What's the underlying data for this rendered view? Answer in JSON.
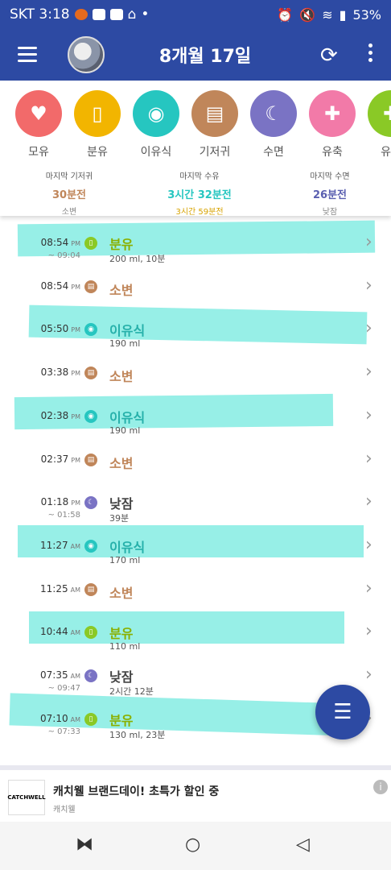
{
  "status": {
    "left": "SKT 3:18",
    "battery": "53%"
  },
  "header": {
    "title": "8개월 17일"
  },
  "colors": {
    "primary": "#2d4aa3",
    "highlight": "#2fe0d0"
  },
  "categories": [
    {
      "label": "모유",
      "icon": "breastfeeding-icon",
      "color": "#f26a6a"
    },
    {
      "label": "분유",
      "icon": "bottle-icon",
      "color": "#f2b500"
    },
    {
      "label": "이유식",
      "icon": "babyfood-icon",
      "color": "#26c6c0"
    },
    {
      "label": "기저귀",
      "icon": "diaper-icon",
      "color": "#c0865a"
    },
    {
      "label": "수면",
      "icon": "sleep-icon",
      "color": "#7a73c4"
    },
    {
      "label": "유축",
      "icon": "pump-icon",
      "color": "#f27aa8"
    },
    {
      "label": "유축",
      "icon": "pump-icon",
      "color": "#8ac926"
    }
  ],
  "summary": [
    {
      "title": "마지막 기저귀",
      "value": "30분전",
      "sub": "소변"
    },
    {
      "title": "마지막 수유",
      "value": "3시간 32분전",
      "sub": "3시간 59분전"
    },
    {
      "title": "마지막 수면",
      "value": "26분전",
      "sub": "낮잠"
    }
  ],
  "records": [
    {
      "time": "08:54",
      "ampm": "PM",
      "end": "~ 09:04",
      "name": "분유",
      "detail": "200 ml, 10분",
      "type": "bottle"
    },
    {
      "time": "08:54",
      "ampm": "PM",
      "end": "",
      "name": "소변",
      "detail": "",
      "type": "diaper"
    },
    {
      "time": "05:50",
      "ampm": "PM",
      "end": "",
      "name": "이유식",
      "detail": "190 ml",
      "type": "food"
    },
    {
      "time": "03:38",
      "ampm": "PM",
      "end": "",
      "name": "소변",
      "detail": "",
      "type": "diaper"
    },
    {
      "time": "02:38",
      "ampm": "PM",
      "end": "",
      "name": "이유식",
      "detail": "190 ml",
      "type": "food"
    },
    {
      "time": "02:37",
      "ampm": "PM",
      "end": "",
      "name": "소변",
      "detail": "",
      "type": "diaper"
    },
    {
      "time": "01:18",
      "ampm": "PM",
      "end": "~ 01:58",
      "name": "낮잠",
      "detail": "39분",
      "type": "sleep"
    },
    {
      "time": "11:27",
      "ampm": "AM",
      "end": "",
      "name": "이유식",
      "detail": "170 ml",
      "type": "food"
    },
    {
      "time": "11:25",
      "ampm": "AM",
      "end": "",
      "name": "소변",
      "detail": "",
      "type": "diaper"
    },
    {
      "time": "10:44",
      "ampm": "AM",
      "end": "",
      "name": "분유",
      "detail": "110 ml",
      "type": "bottle"
    },
    {
      "time": "07:35",
      "ampm": "AM",
      "end": "~ 09:47",
      "name": "낮잠",
      "detail": "2시간 12분",
      "type": "sleep"
    },
    {
      "time": "07:10",
      "ampm": "AM",
      "end": "~ 07:33",
      "name": "분유",
      "detail": "130 ml, 23분",
      "type": "bottle"
    }
  ],
  "ad": {
    "logo": "CATCHWELL",
    "title": "캐치웰 브랜드데이! 초특가 할인 중",
    "brand": "캐치웰"
  }
}
